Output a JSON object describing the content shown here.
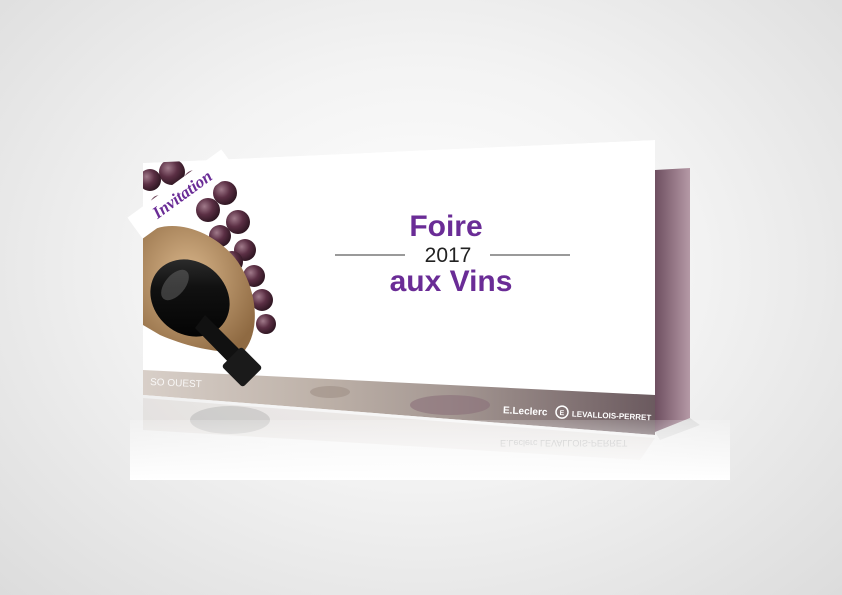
{
  "card": {
    "badge": "Invitation",
    "title_line1": "Foire",
    "year": "2017",
    "title_line2": "aux Vins",
    "footer_left": "SO OUEST",
    "brand_name": "E.Leclerc",
    "brand_location": "LEVALLOIS-PERRET"
  },
  "colors": {
    "purple": "#6a2c96",
    "back_panel": "#8a6a78",
    "rule": "#9a9a9a",
    "footer_band": "#b8aaa0"
  },
  "icons": {
    "brand_logo": "leclerc-logo-icon",
    "grapes": "grapes-illustration",
    "bottle": "wine-bottle-illustration"
  }
}
